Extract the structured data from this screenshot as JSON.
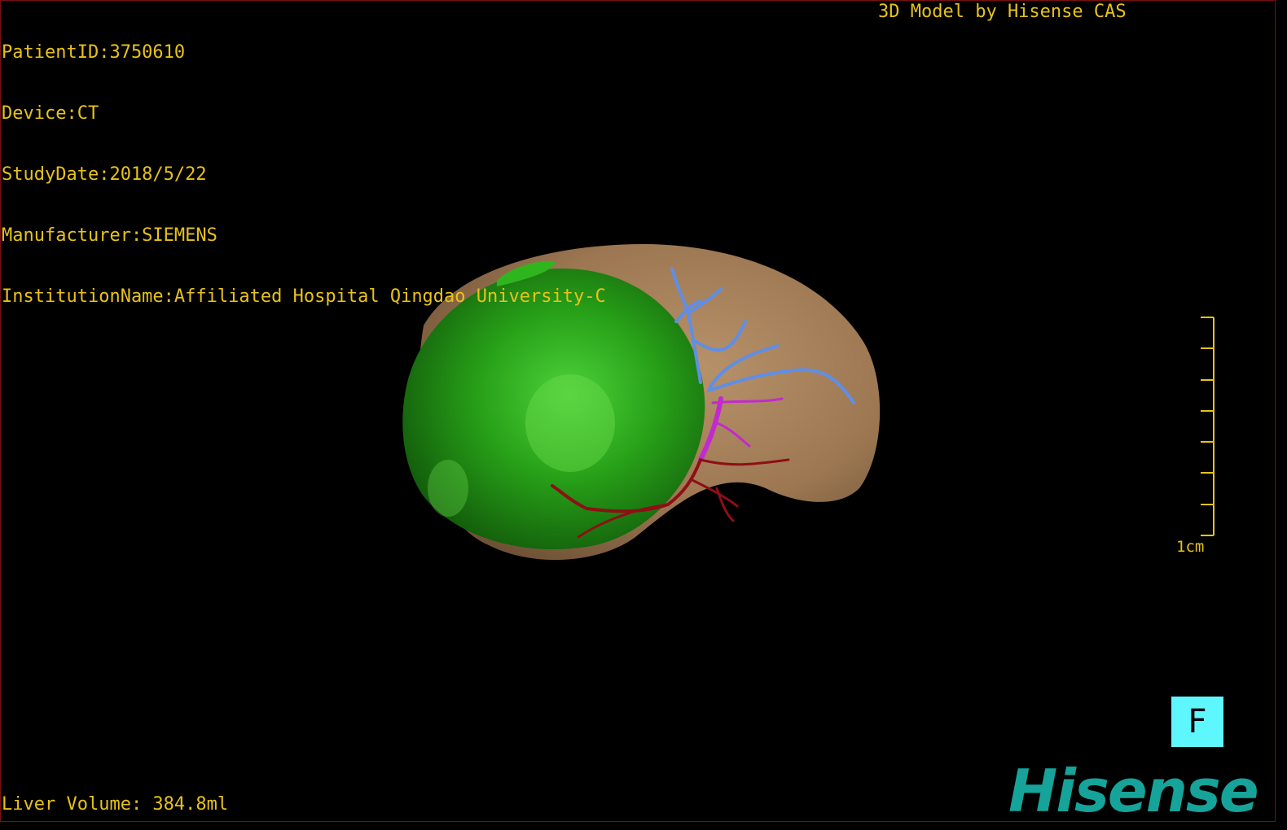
{
  "overlay": {
    "patient_id": "PatientID:3750610",
    "device": "Device:CT",
    "study_date": "StudyDate:2018/5/22",
    "manufacturer": "Manufacturer:SIEMENS",
    "institution": "InstitutionName:Affiliated Hospital Qingdao University-C",
    "credit": "3D Model by Hisense CAS",
    "liver_volume": "Liver Volume: 384.8ml",
    "scale_label": "1cm"
  },
  "orientation": {
    "label": "F"
  },
  "brand": {
    "name": "Hisense"
  },
  "colors": {
    "overlay_text": "#e8c21a",
    "liver": "#b08a63",
    "tumor": "#2aa81a",
    "portal_vein": "#5f8ee8",
    "hepatic_vein": "#c22ad0",
    "artery": "#8e0f15",
    "orientation_bg": "#5ff7ff",
    "brand": "#16a39a"
  }
}
